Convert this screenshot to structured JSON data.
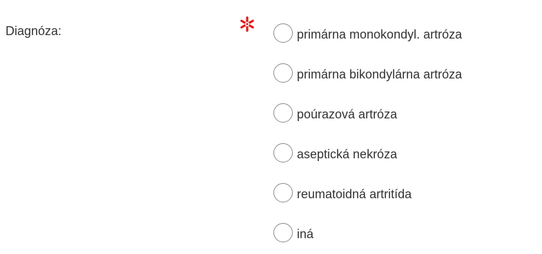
{
  "form": {
    "diagnosis": {
      "label": "Diagnóza:",
      "required": true,
      "required_icon": "required-asterisk-icon",
      "required_color": "#e31b1b",
      "options": [
        {
          "label": "primárna monokondyl. artróza",
          "selected": false
        },
        {
          "label": "primárna bikondylárna artróza",
          "selected": false
        },
        {
          "label": "poúrazová artróza",
          "selected": false
        },
        {
          "label": "aseptická nekróza",
          "selected": false
        },
        {
          "label": "reumatoidná artritída",
          "selected": false
        },
        {
          "label": "iná",
          "selected": false
        }
      ]
    }
  }
}
